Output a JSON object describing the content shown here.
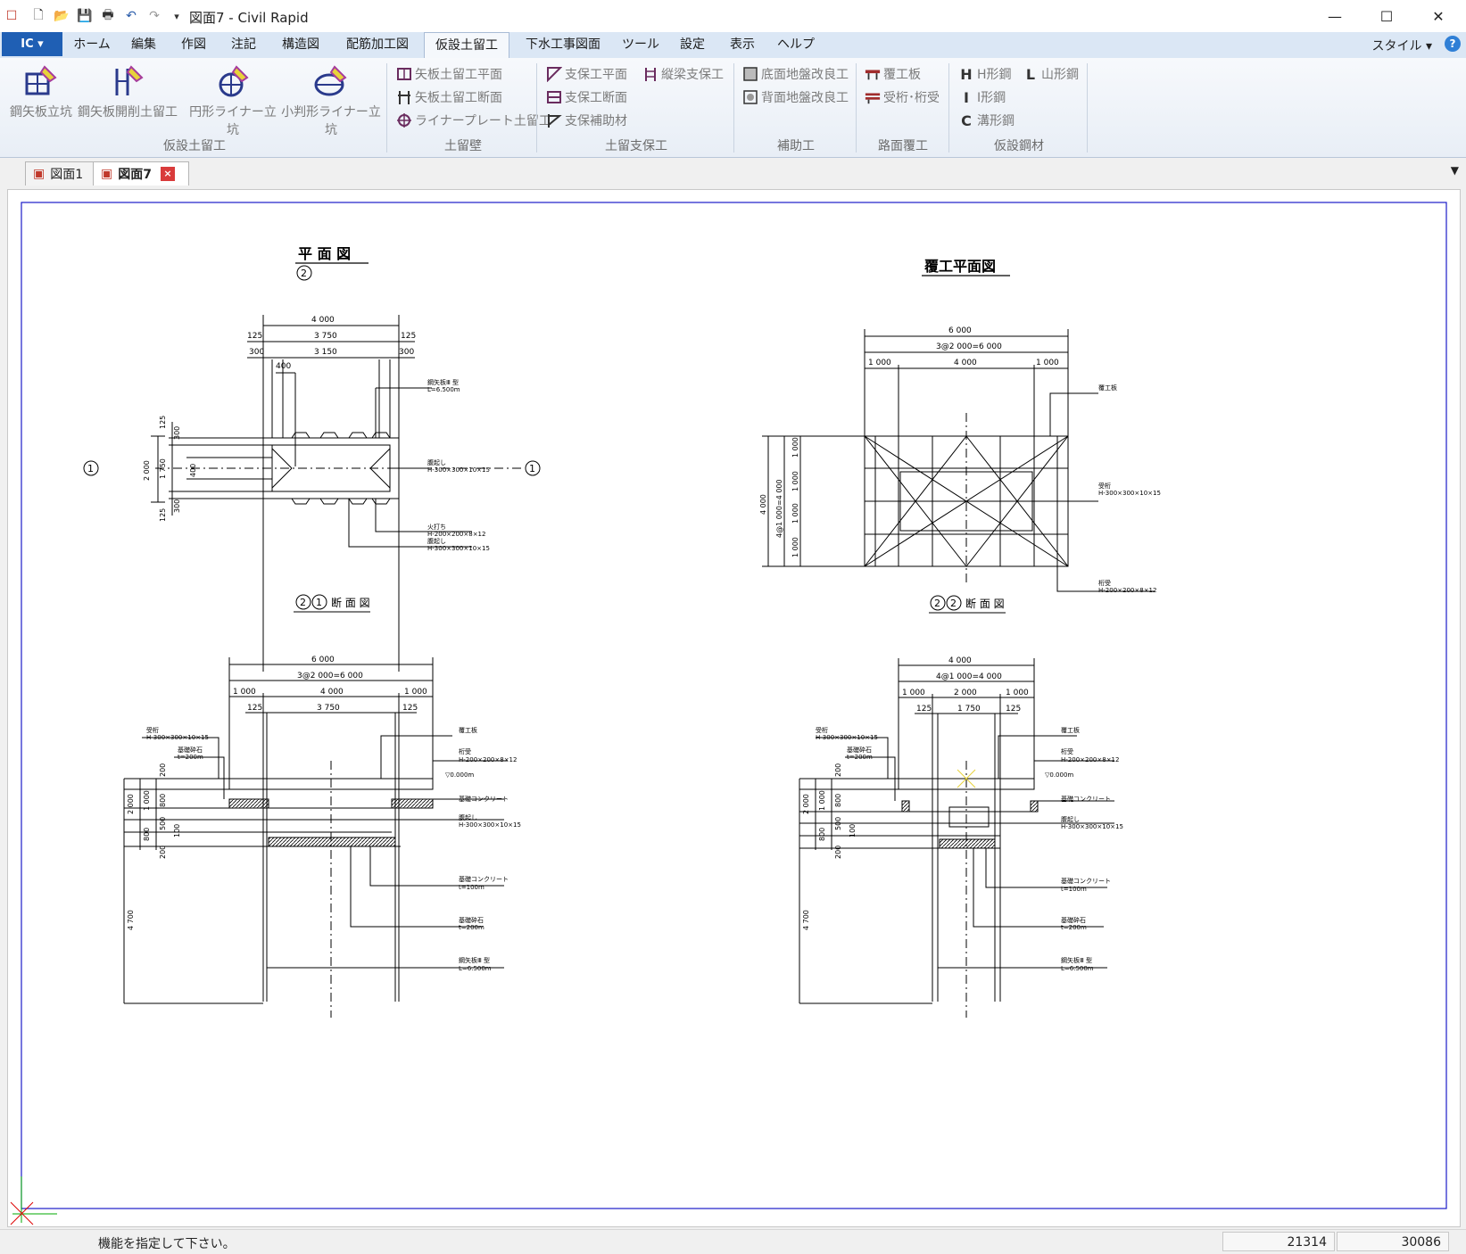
{
  "window": {
    "title": "図面7 - Civil Rapid"
  },
  "menu": {
    "app_button": "IC",
    "tabs": [
      "ホーム",
      "編集",
      "作図",
      "注記",
      "構造図",
      "配筋加工図",
      "仮設土留工",
      "下水工事図面",
      "ツール",
      "設定",
      "表示",
      "ヘルプ"
    ],
    "active_tab": "仮設土留工",
    "style": "スタイル"
  },
  "ribbon": {
    "big_buttons": [
      "鋼矢板立坑",
      "鋼矢板開削土留工",
      "円形ライナー立坑",
      "小判形ライナー立坑"
    ],
    "group_kasetsu": "仮設土留工",
    "dodomeheki": [
      "矢板土留工平面",
      "矢板土留工断面",
      "ライナープレート土留工"
    ],
    "group_dodomeheki": "土留壁",
    "shiho": [
      "支保工平面",
      "支保工断面",
      "支保補助材",
      "縦梁支保工"
    ],
    "group_shiho": "土留支保工",
    "hojo": [
      "底面地盤改良工",
      "背面地盤改良工"
    ],
    "group_hojo": "補助工",
    "romen": [
      "覆工板",
      "受桁･桁受"
    ],
    "group_romen": "路面覆工",
    "kouzai": [
      "H形鋼",
      "I形鋼",
      "溝形鋼",
      "山形鋼"
    ],
    "group_kouzai": "仮設鋼材"
  },
  "doc_tabs": [
    "図面1",
    "図面7"
  ],
  "active_doc": "図面7",
  "drawing": {
    "plan_title": "平 面 図",
    "fukukou_title": "覆工平面図",
    "sec11_title": "断 面 図",
    "sec22_title": "断 面 図",
    "mark1": "1",
    "mark2": "2",
    "plan_dims": [
      "4 000",
      "125",
      "3 750",
      "125",
      "300",
      "3 150",
      "300",
      "400"
    ],
    "plan_vdims": [
      "125",
      "300",
      "2 000",
      "1 750",
      "400",
      "300",
      "125"
    ],
    "plan_notes": [
      "鋼矢板Ⅲ 型",
      "L=6.500m",
      "腹起し",
      "H-300×300×10×15",
      "火打ち",
      "H-200×200×8×12",
      "腹起し",
      "H-300×300×10×15"
    ],
    "fukukou_dims": [
      "6 000",
      "3@2 000=6 000",
      "1 000",
      "4 000",
      "1 000"
    ],
    "fukukou_vdims": [
      "4 000",
      "4@1 000=4 000",
      "1 000",
      "1 000",
      "1 000",
      "1 000"
    ],
    "fukukou_notes": [
      "覆工板",
      "受桁",
      "H-300×300×10×15",
      "桁受",
      "H-200×200×8×12"
    ],
    "sec11_dims": [
      "6 000",
      "3@2 000=6 000",
      "1 000",
      "4 000",
      "1 000",
      "125",
      "3 750",
      "125"
    ],
    "sec22_dims": [
      "4 000",
      "4@1 000=4 000",
      "1 000",
      "2 000",
      "1 000",
      "125",
      "1 750",
      "125"
    ],
    "sec_vdims": [
      "2 000",
      "1 000",
      "800",
      "200",
      "800",
      "500",
      "200",
      "4 700",
      "200",
      "100"
    ],
    "sec_notes": [
      "受桁",
      "H-300×300×10×15",
      "基礎砕石",
      "t=200m",
      "覆工板",
      "桁受",
      "H-200×200×8×12",
      "基礎コンクリート",
      "腹起し",
      "H-300×300×10×15",
      "基礎コンクリート",
      "t=100m",
      "基礎砕石",
      "t=200m",
      "鋼矢板Ⅲ 型",
      "L=6.500m"
    ],
    "sec_level": "▽0.000m"
  },
  "status": {
    "message": "機能を指定して下さい。",
    "x": "21314",
    "y": "30086"
  }
}
